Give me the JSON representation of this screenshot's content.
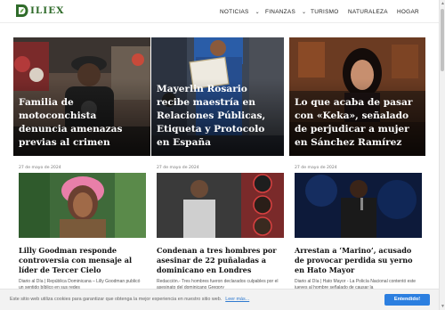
{
  "site": {
    "logo_text": "ILIEX"
  },
  "nav": {
    "items": [
      {
        "label": "NOTICIAS",
        "has_dropdown": true
      },
      {
        "label": "FINANZAS",
        "has_dropdown": true
      },
      {
        "label": "TURISMO",
        "has_dropdown": false
      },
      {
        "label": "NATURALEZA",
        "has_dropdown": false
      },
      {
        "label": "HOGAR",
        "has_dropdown": false
      }
    ],
    "chevron": "⌵"
  },
  "hero": [
    {
      "title": "Familia de motoconchista denuncia amenazas previas al crimen",
      "image": "mechanic-shop-photo"
    },
    {
      "title": "Mayerlin Rosario recibe maestría en Relaciones Públicas, Etiqueta y Protocolo en España",
      "image": "graduation-photo"
    },
    {
      "title": "Lo que acaba de pasar con «Keka», señalado de perjudicar a mujer en Sánchez Ramírez",
      "image": "woman-portrait-photo"
    }
  ],
  "cards": [
    {
      "date": "27 de mayo de 2024",
      "title": "Lilly Goodman responde controversia con mensaje al líder de Tercer Cielo",
      "excerpt": "Diario al Día | República Dominicana – Lilly Goodman publicó un sentido bíblico en sus redes",
      "image": "singer-portrait-photo"
    },
    {
      "date": "27 de mayo de 2024",
      "title": "Condenan a tres hombres por asesinar de 22 puñaladas a dominicano en Londres",
      "excerpt": "Redacción.- Tres hombres fueron declarados culpables por el asesinato del dominicano Gregory",
      "image": "suspects-photo"
    },
    {
      "date": "27 de mayo de 2024",
      "title": "Arrestan a ‘Marino’, acusado de provocar perdida su yerno en Hato Mayor",
      "excerpt": "Diario al Día | Hato Mayor - La Policía Nacional contentó este jueves al hombre señalado de causar la",
      "image": "man-with-microphone-photo"
    }
  ],
  "cookie": {
    "text": "Este sitio web utiliza cookies para garantizar que obtenga la mejor experiencia en nuestro sitio web.",
    "link": "Leer más...",
    "button": "Entendido!"
  },
  "colors": {
    "brand_green": "#2f6b2a",
    "accept_blue": "#2c7fe0",
    "link_blue": "#2f7ad0"
  }
}
